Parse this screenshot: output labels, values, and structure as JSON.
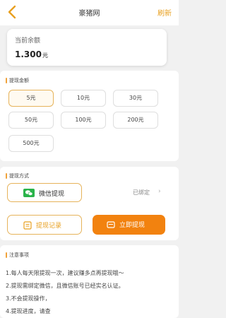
{
  "header": {
    "title": "豪猪网",
    "refresh_label": "刷新",
    "accent_color": "#e8a020"
  },
  "balance": {
    "label": "当前余额",
    "value": "1.300",
    "unit": "元"
  },
  "amount_section": {
    "title": "提现金额",
    "options": [
      "5元",
      "10元",
      "30元",
      "50元",
      "100元",
      "200元",
      "500元"
    ],
    "selected": "5元"
  },
  "method_section": {
    "title": "提现方式",
    "method_label": "微信提现",
    "method_icon": "wechat-icon",
    "bound_status": "已绑定",
    "chevron": "›"
  },
  "actions": {
    "record_label": "提现记录",
    "withdraw_label": "立即提现",
    "withdraw_color": "#f2820f"
  },
  "notice": {
    "title": "注意事项",
    "lines": [
      "1.每人每天限提现一次，建议赚多点再提现哦～",
      "2.提现需绑定微信，且微信账号已经实名认证。",
      "3.不会提现操作，",
      "4.提现进度，请查"
    ]
  }
}
